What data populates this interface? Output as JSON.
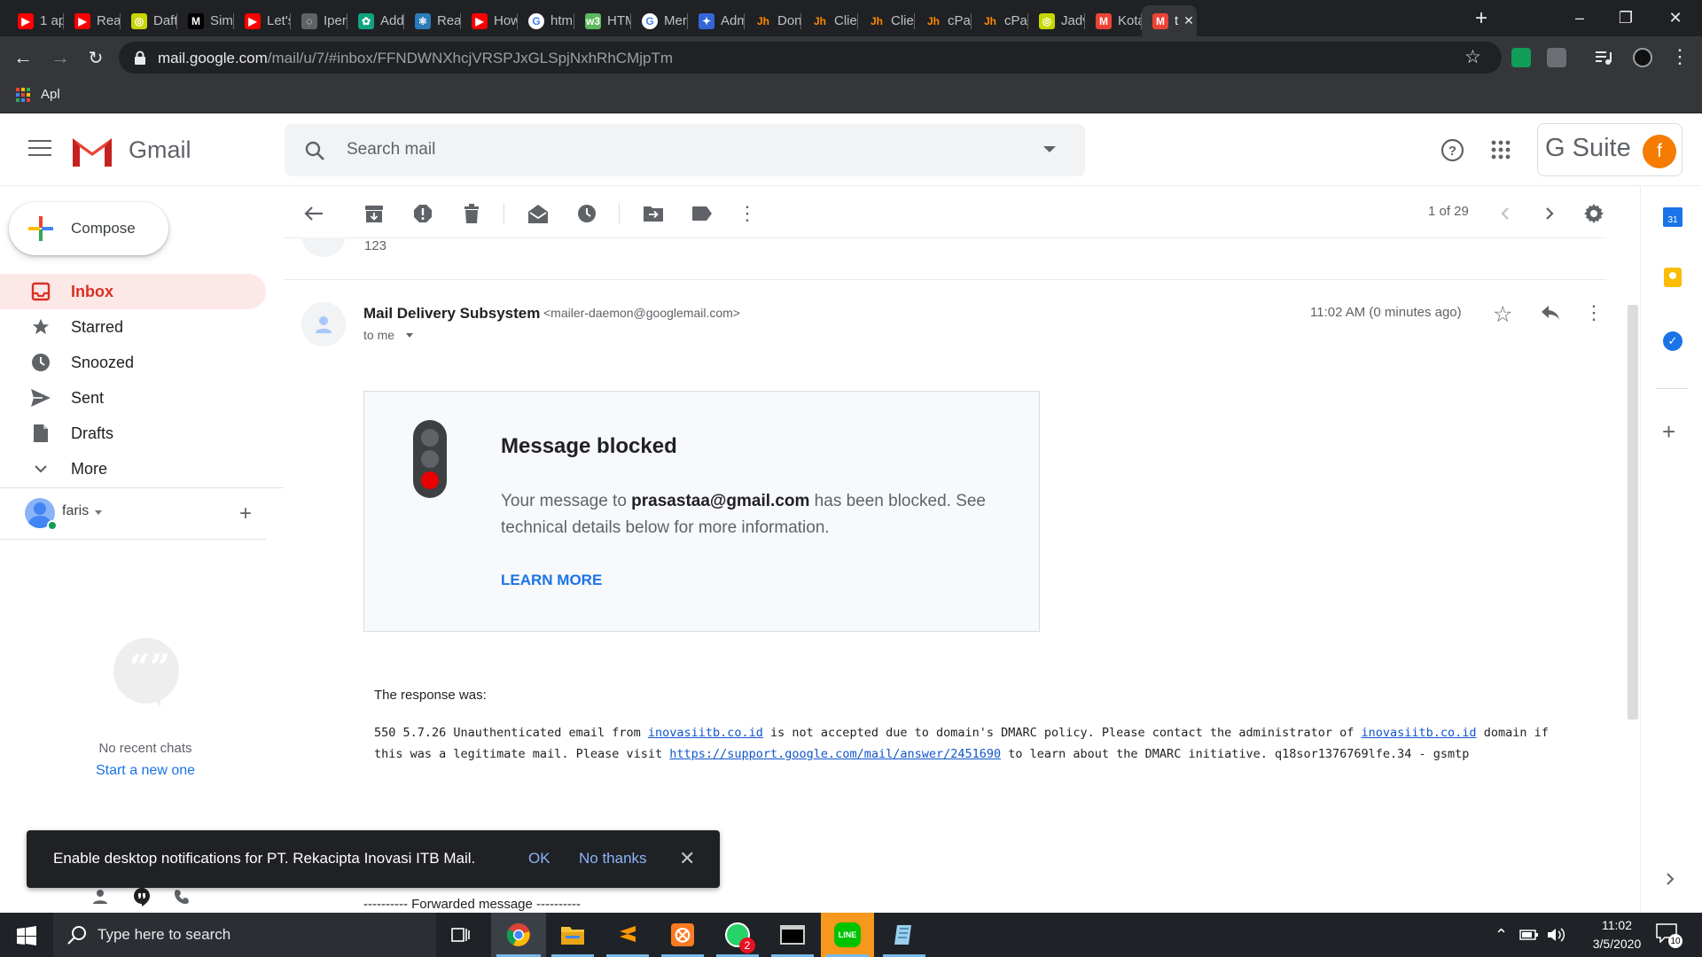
{
  "browser": {
    "tabs": [
      {
        "label": "1 ap",
        "color": "#ff0000",
        "glyph": "▶"
      },
      {
        "label": "Reac",
        "color": "#ff0000",
        "glyph": "▶"
      },
      {
        "label": "Daft",
        "color": "#c6d600",
        "glyph": "◎"
      },
      {
        "label": "Simp",
        "color": "#000000",
        "glyph": "M"
      },
      {
        "label": "Let's",
        "color": "#ff0000",
        "glyph": "▶"
      },
      {
        "label": "Iper",
        "color": "#5f6368",
        "glyph": "◌"
      },
      {
        "label": "Add",
        "color": "#10a37f",
        "glyph": "✿"
      },
      {
        "label": "Reac",
        "color": "#2b7bb9",
        "glyph": "⚛"
      },
      {
        "label": "How",
        "color": "#ff0000",
        "glyph": "▶"
      },
      {
        "label": "htm",
        "color": "#ffffff",
        "glyph": "G"
      },
      {
        "label": "HTM",
        "color": "#5cb85c",
        "glyph": "w3"
      },
      {
        "label": "Mer",
        "color": "#ffffff",
        "glyph": "G"
      },
      {
        "label": "Adm",
        "color": "#3367d6",
        "glyph": "✦"
      },
      {
        "label": "Don",
        "color": "#ff8a00",
        "glyph": "Jh"
      },
      {
        "label": "Clie",
        "color": "#ff8a00",
        "glyph": "Jh"
      },
      {
        "label": "Clie",
        "color": "#ff8a00",
        "glyph": "Jh"
      },
      {
        "label": "cPar",
        "color": "#ff8a00",
        "glyph": "Jh"
      },
      {
        "label": "cPar",
        "color": "#ff8a00",
        "glyph": "Jh"
      },
      {
        "label": "Jadv",
        "color": "#c6d600",
        "glyph": "◎"
      },
      {
        "label": "Kota",
        "color": "#ea4335",
        "glyph": "M"
      },
      {
        "label": "t",
        "color": "#ea4335",
        "glyph": "M",
        "active": true
      }
    ],
    "url_domain": "mail.google.com",
    "url_path": "/mail/u/7/#inbox/FFNDWNXhcjVRSPJxGLSpjNxhRhCMjpTm",
    "bookmark_apps_label": "Apl"
  },
  "gmail": {
    "logo_text": "Gmail",
    "search_placeholder": "Search mail",
    "gsuite_label": "G Suite",
    "avatar_letter": "f",
    "compose_label": "Compose",
    "nav": [
      {
        "label": "Inbox",
        "icon": "inbox-icon",
        "active": true
      },
      {
        "label": "Starred",
        "icon": "star-icon"
      },
      {
        "label": "Snoozed",
        "icon": "clock-icon"
      },
      {
        "label": "Sent",
        "icon": "send-icon"
      },
      {
        "label": "Drafts",
        "icon": "draft-icon"
      },
      {
        "label": "More",
        "icon": "chevron-down-icon"
      }
    ],
    "hangouts_user": "faris",
    "no_chats": "No recent chats",
    "start_new": "Start a new one",
    "pager": "1 of 29"
  },
  "email": {
    "prev_snippet": "123",
    "sender_name": "Mail Delivery Subsystem",
    "sender_email": "<mailer-daemon@googlemail.com>",
    "to": "to me",
    "time": "11:02 AM (0 minutes ago)",
    "card_title": "Message blocked",
    "card_text_pre": "Your message to ",
    "card_recipient": "prasastaa@gmail.com",
    "card_text_post": " has been blocked. See technical details below for more information.",
    "learn_more": "LEARN MORE",
    "response_label": "The response was:",
    "response_line1_a": "550 5.7.26 Unauthenticated email from ",
    "response_link1": "inovasiitb.co.id",
    "response_line1_b": " is not accepted due to domain's DMARC policy. Please contact the administrator of ",
    "response_link2": "inovasiitb.co.id",
    "response_line1_c": " domain if",
    "response_line2_a": "this was a legitimate mail. Please visit ",
    "response_link3": "https://support.google.com/mail/answer/2451690",
    "response_line2_b": " to learn about the DMARC initiative. q18sor1376769lfe.34 - gsmtp",
    "forwarded": "---------- Forwarded message ----------"
  },
  "notification": {
    "text": "Enable desktop notifications for PT. Rekacipta Inovasi ITB Mail.",
    "ok": "OK",
    "no_thanks": "No thanks"
  },
  "taskbar": {
    "search_placeholder": "Type here to search",
    "time": "11:02",
    "date": "3/5/2020",
    "whatsapp_badge": "2",
    "notif_count": "10"
  }
}
